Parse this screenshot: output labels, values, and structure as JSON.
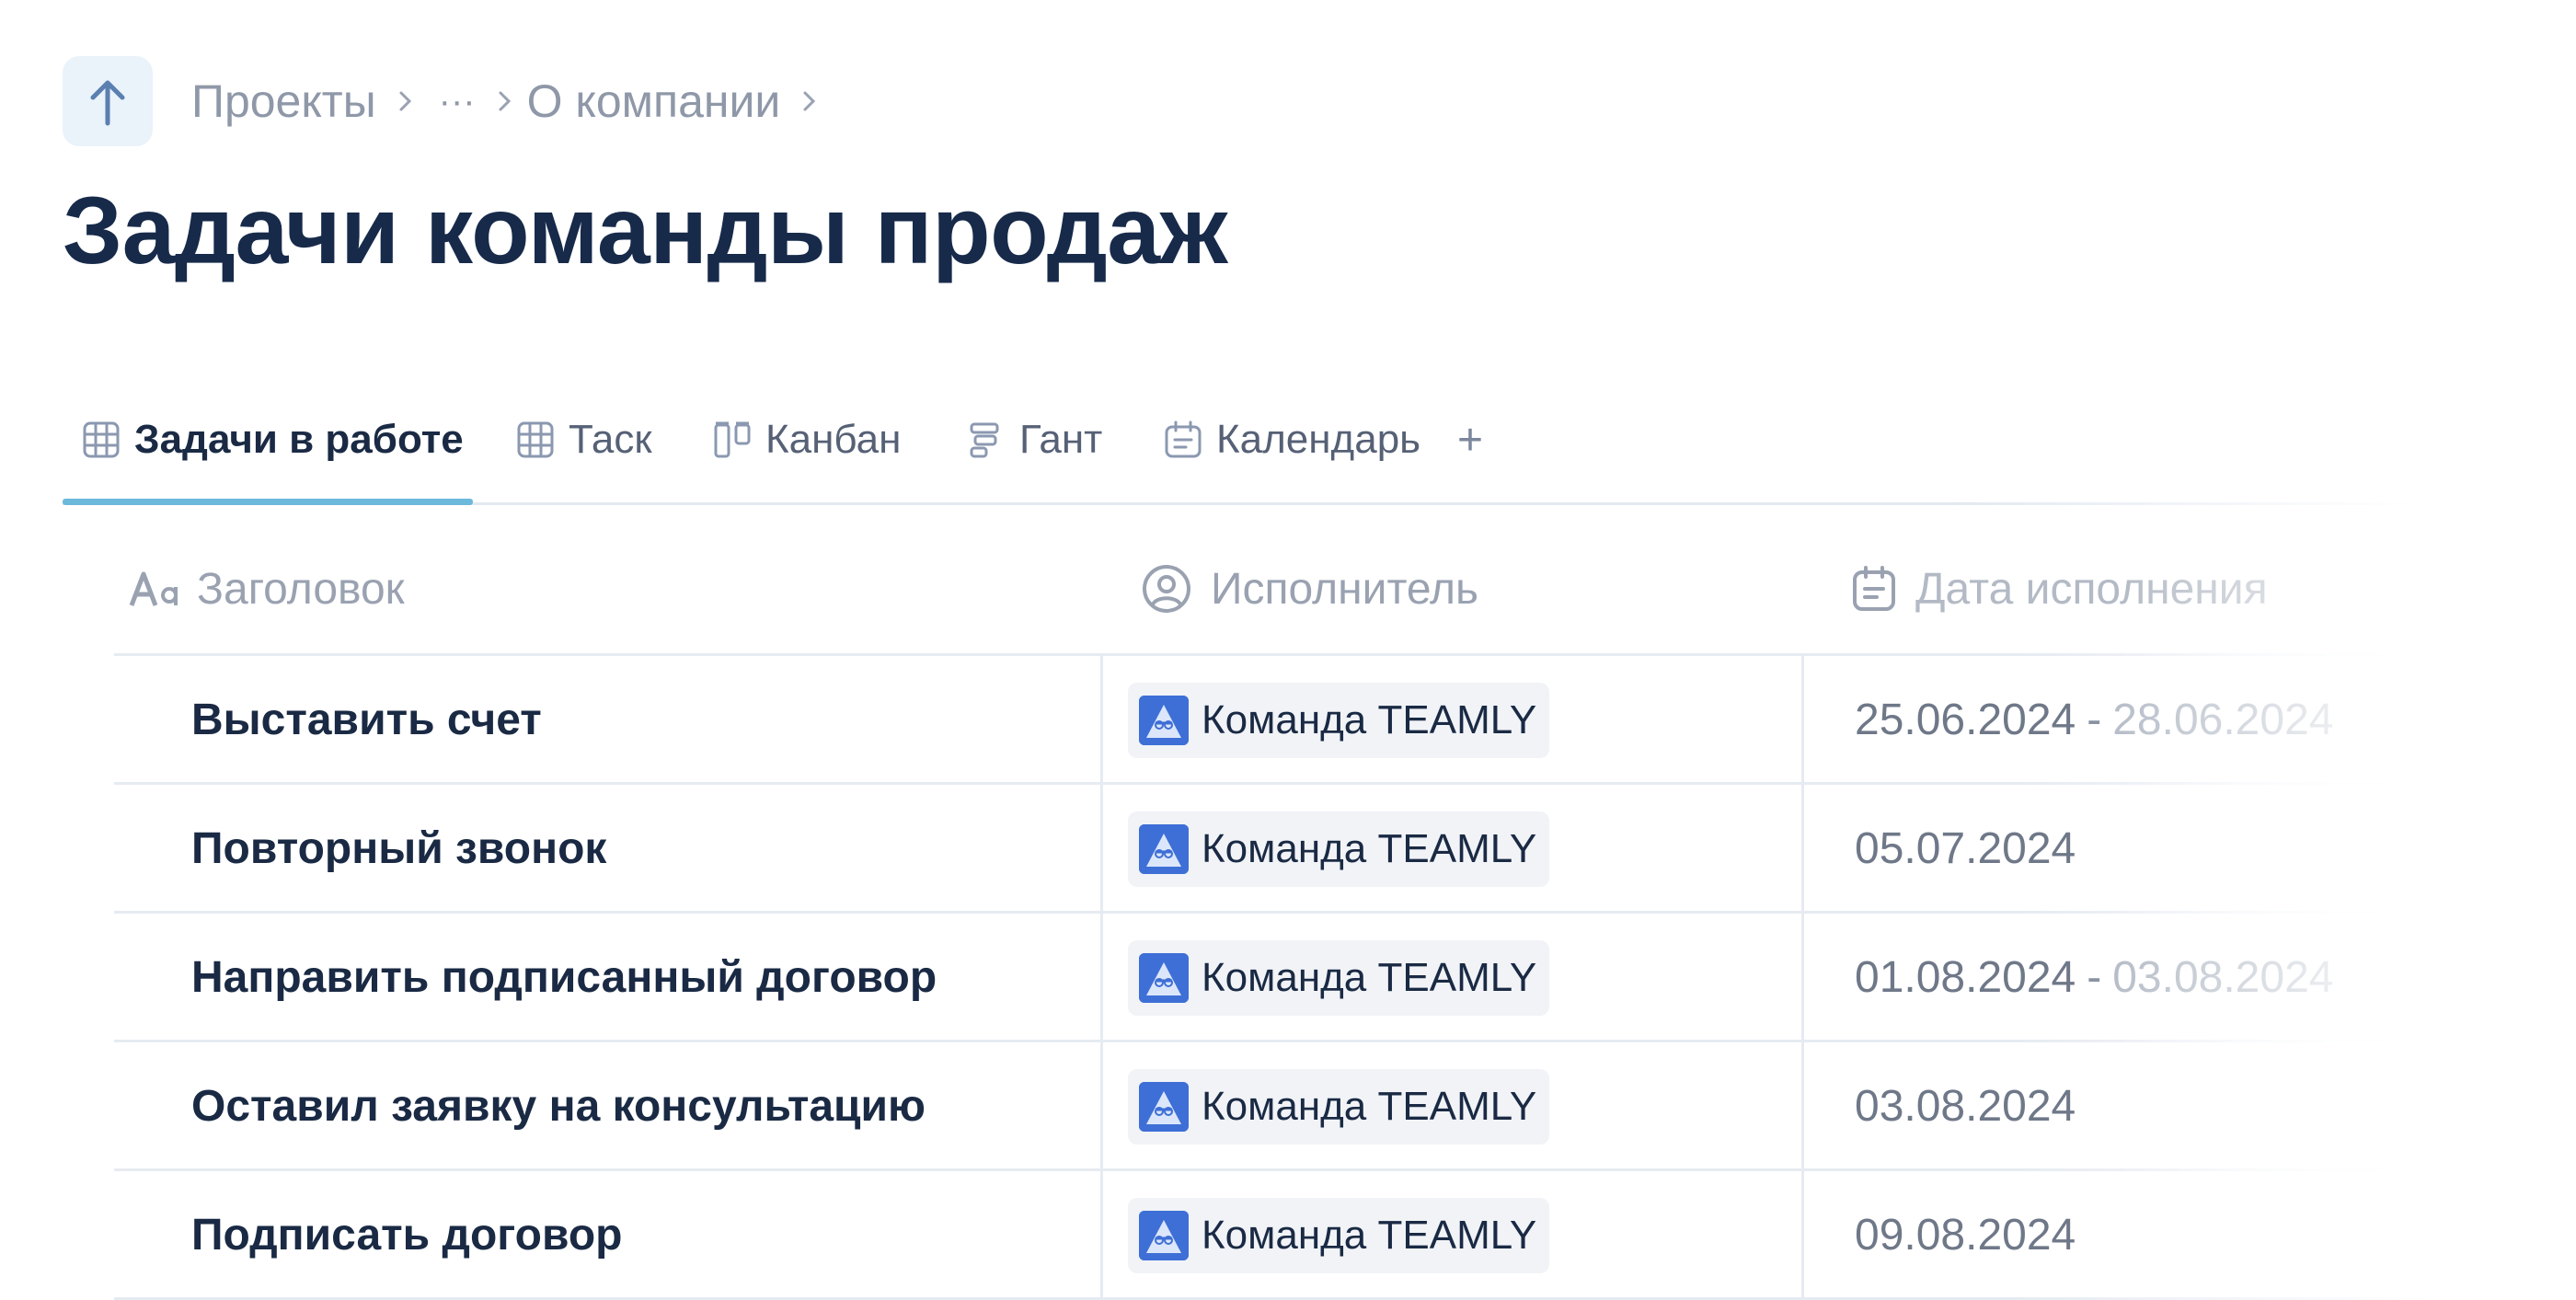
{
  "breadcrumb": {
    "items": [
      "Проекты",
      "···",
      "О компании"
    ]
  },
  "page": {
    "title": "Задачи команды продаж"
  },
  "tabs": [
    {
      "label": "Задачи в работе",
      "icon": "table-grid-icon",
      "active": true
    },
    {
      "label": "Таск",
      "icon": "table-grid-icon"
    },
    {
      "label": "Канбан",
      "icon": "kanban-icon"
    },
    {
      "label": "Гант",
      "icon": "gantt-icon"
    },
    {
      "label": "Календарь",
      "icon": "calendar-icon"
    },
    {
      "label": "+",
      "icon": "plus-icon"
    }
  ],
  "table": {
    "columns": [
      {
        "label": "Заголовок",
        "icon": "text-type-icon"
      },
      {
        "label": "Исполнитель",
        "icon": "user-circle-icon"
      },
      {
        "label": "Дата исполнения",
        "icon": "calendar-icon"
      }
    ],
    "rows": [
      {
        "title": "Выставить счет",
        "assignee": "Команда TEAMLY",
        "date_start": "25.06.2024",
        "date_sep": "-",
        "date_end": "28.06.2024"
      },
      {
        "title": "Повторный звонок",
        "assignee": "Команда TEAMLY",
        "date_start": "05.07.2024",
        "date_sep": "",
        "date_end": ""
      },
      {
        "title": "Направить подписанный договор",
        "assignee": "Команда TEAMLY",
        "date_start": "01.08.2024",
        "date_sep": "-",
        "date_end": "03.08.2024"
      },
      {
        "title": "Оставил заявку на консультацию",
        "assignee": "Команда TEAMLY",
        "date_start": "03.08.2024",
        "date_sep": "",
        "date_end": ""
      },
      {
        "title": "Подписать договор",
        "assignee": "Команда TEAMLY",
        "date_start": "09.08.2024",
        "date_sep": "",
        "date_end": ""
      }
    ]
  },
  "colors": {
    "accent": "#6bb9db",
    "title": "#172a4a",
    "muted": "#8f98a8",
    "avatar": "#3e6fd6"
  }
}
